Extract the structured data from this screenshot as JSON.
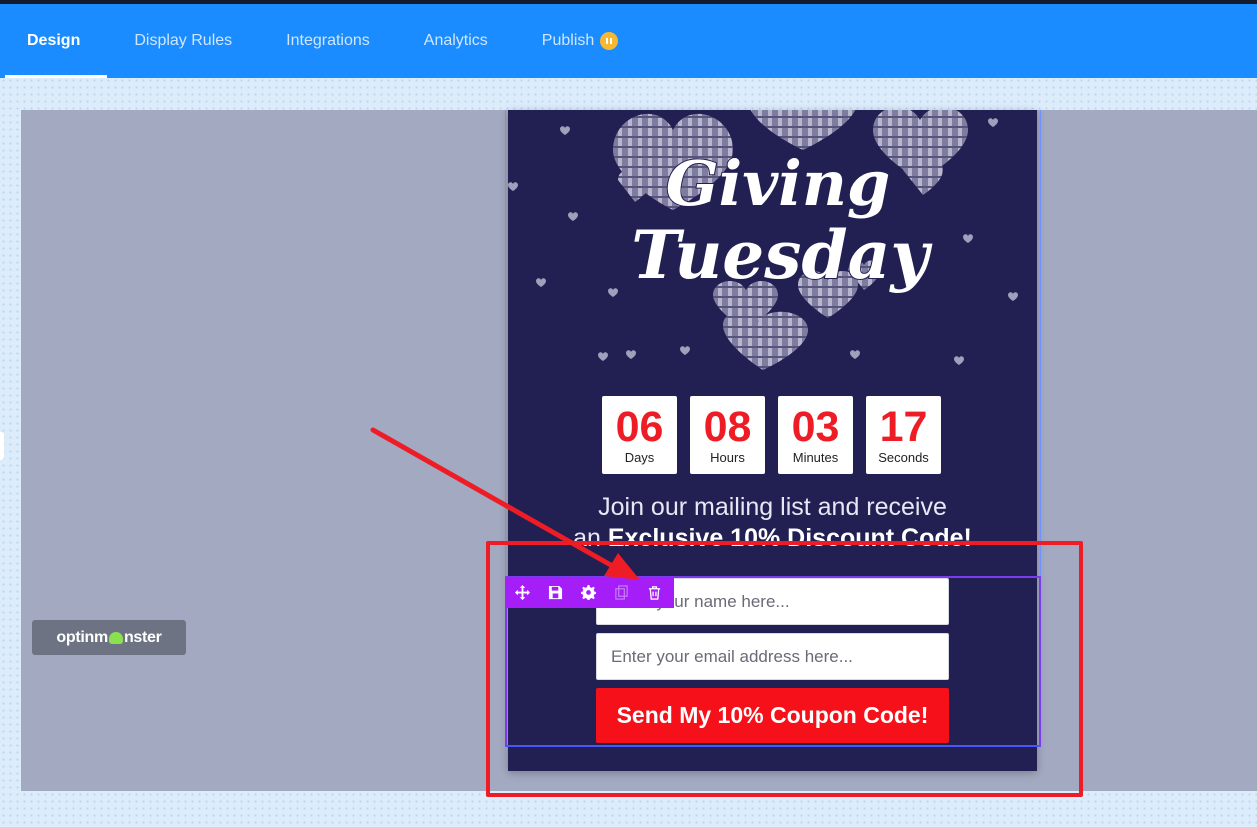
{
  "nav": {
    "tabs": [
      {
        "label": "Design"
      },
      {
        "label": "Display Rules"
      },
      {
        "label": "Integrations"
      },
      {
        "label": "Analytics"
      },
      {
        "label": "Publish"
      }
    ],
    "active_tab": "Design",
    "publish_status": "paused"
  },
  "brand": {
    "badge_text_left": "optinm",
    "badge_text_right": "nster"
  },
  "campaign": {
    "title_line1": "Giving",
    "title_line2": "Tuesday",
    "countdown": [
      {
        "value": "06",
        "label": "Days"
      },
      {
        "value": "08",
        "label": "Hours"
      },
      {
        "value": "03",
        "label": "Minutes"
      },
      {
        "value": "17",
        "label": "Seconds"
      }
    ],
    "headline_line1": "Join our mailing list and receive",
    "headline_line2_prefix": "an",
    "headline_line2_bold": "Exclusive 10% Discount Code!",
    "name_placeholder": "Enter your name here...",
    "email_placeholder": "Enter your email address here...",
    "submit_label": "Send My 10% Coupon Code!"
  },
  "element_toolbar": {
    "tools": [
      "move-icon",
      "save-icon",
      "gear-icon",
      "duplicate-icon",
      "trash-icon"
    ]
  },
  "colors": {
    "topbar": "#1a8cff",
    "campaign_bg": "#222052",
    "accent_red": "#ee1c25",
    "toolbar_purple": "#a51ef7",
    "publish_badge": "#f5b82e"
  }
}
